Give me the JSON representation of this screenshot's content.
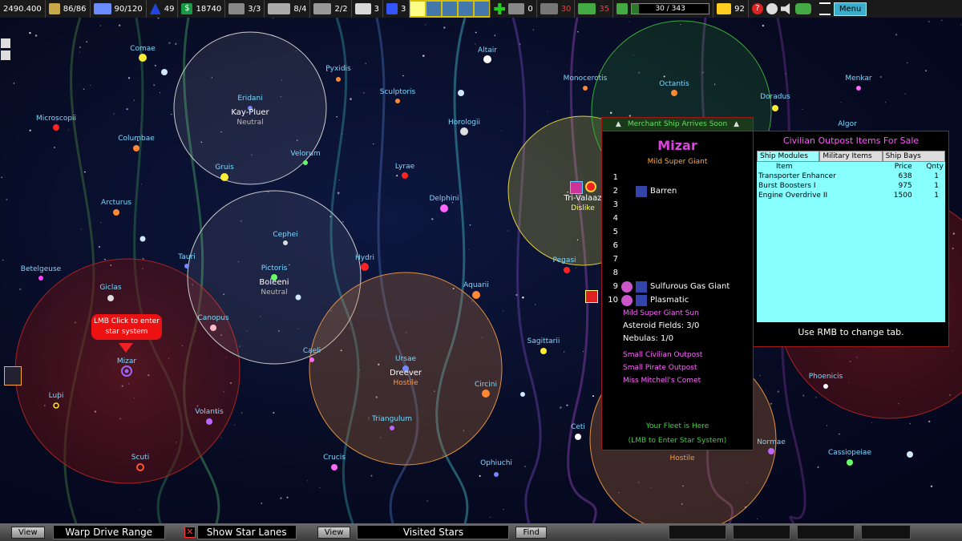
{
  "topbar": {
    "stardate": "2490.400",
    "crew": "86/86",
    "troops": "90/120",
    "fuel": "49",
    "credits": "18740",
    "ships_a": "3/3",
    "ships_b": "8/4",
    "ships_c": "2/2",
    "passengers": "3",
    "pilots": "3",
    "stat_green": "0",
    "stat_red1": "30",
    "stat_red2": "35",
    "cargo": "30 / 343",
    "cargo_fill": 0.087,
    "morale": "92",
    "menu": "Menu"
  },
  "stars": [
    {
      "name": "Comae"
    },
    {
      "name": "Microscopii"
    },
    {
      "name": "Columbae"
    },
    {
      "name": "Arcturus"
    },
    {
      "name": "Betelgeuse"
    },
    {
      "name": "Giclas"
    },
    {
      "name": "Tauri"
    },
    {
      "name": "Canopus"
    },
    {
      "name": "Lupi"
    },
    {
      "name": "Volantis"
    },
    {
      "name": "Scuti"
    },
    {
      "name": "Gruis"
    },
    {
      "name": "Velorum"
    },
    {
      "name": "Pyxidis"
    },
    {
      "name": "Sculptoris"
    },
    {
      "name": "Lyrae"
    },
    {
      "name": "Horologii"
    },
    {
      "name": "Delphini"
    },
    {
      "name": "Cephei"
    },
    {
      "name": "Hydri"
    },
    {
      "name": "Caeli"
    },
    {
      "name": "Aquarii"
    },
    {
      "name": "Circini"
    },
    {
      "name": "Triangulum"
    },
    {
      "name": "Crucis"
    },
    {
      "name": "Ophiuchi"
    },
    {
      "name": "Altair"
    },
    {
      "name": "Monocerotis"
    },
    {
      "name": "Octantis"
    },
    {
      "name": "Doradus"
    },
    {
      "name": "Menkar"
    },
    {
      "name": "Algor"
    },
    {
      "name": "Pegasi"
    },
    {
      "name": "Sagittarii"
    },
    {
      "name": "Ceti"
    },
    {
      "name": "Normae"
    },
    {
      "name": "Phoenicis"
    },
    {
      "name": "Cassiopeiae"
    },
    {
      "name": "Mizar"
    }
  ],
  "systems": {
    "eridani": {
      "star": "Eridani",
      "name": "Kay-Pluer",
      "status": "Neutral"
    },
    "pictoris": {
      "star": "Pictoris",
      "name": "Boleeni",
      "status": "Neutral"
    },
    "ursae": {
      "star": "Ursae",
      "name": "Dreever",
      "status": "Hostile"
    },
    "trivalaaz": {
      "name": "Tri-Valaaz",
      "status": "Dislike"
    },
    "southeast": {
      "status": "Hostile"
    }
  },
  "tooltip": "LMB Click to enter star system",
  "panel": {
    "header": "Merchant Ship Arrives Soon",
    "star": "Mizar",
    "star_type": "Mild Super Giant",
    "orbits": [
      {
        "n": "1",
        "label": ""
      },
      {
        "n": "2",
        "label": "Barren"
      },
      {
        "n": "3",
        "label": ""
      },
      {
        "n": "4",
        "label": ""
      },
      {
        "n": "5",
        "label": ""
      },
      {
        "n": "6",
        "label": ""
      },
      {
        "n": "7",
        "label": ""
      },
      {
        "n": "8",
        "label": ""
      },
      {
        "n": "9",
        "label": "Sulfurous Gas Giant"
      },
      {
        "n": "10",
        "label": "Plasmatic"
      }
    ],
    "sun": "Mild Super Giant Sun",
    "asteroid": "Asteroid Fields: 3/0",
    "nebulas": "Nebulas: 1/0",
    "features": [
      "Small Civilian Outpost",
      "Small Pirate Outpost",
      "Miss Mitchell's Comet"
    ],
    "fleet": "Your Fleet is Here",
    "enter": "(LMB to Enter Star System)"
  },
  "trade": {
    "title": "Civilian Outpost Items For Sale",
    "tabs": [
      "Ship Modules",
      "Military Items",
      "Ship Bays"
    ],
    "columns": [
      "Item",
      "Price",
      "Qnty"
    ],
    "rows": [
      {
        "item": "Transporter Enhancer",
        "price": "638",
        "qty": "1"
      },
      {
        "item": "Burst Boosters I",
        "price": "975",
        "qty": "1"
      },
      {
        "item": "Engine Overdrive II",
        "price": "1500",
        "qty": "1"
      }
    ],
    "footer": "Use RMB to change tab."
  },
  "bottombar": {
    "view1": "View",
    "warp": "Warp Drive Range",
    "lanes": "Show Star Lanes",
    "view2": "View",
    "visited": "Visited Stars",
    "find": "Find"
  }
}
